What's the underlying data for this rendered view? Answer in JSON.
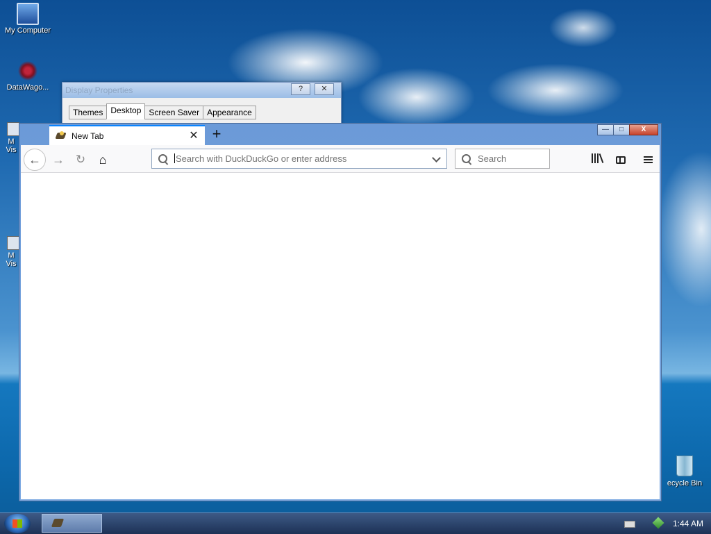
{
  "desktop": {
    "icons": [
      {
        "label": "My Computer"
      },
      {
        "label": "DataWago..."
      },
      {
        "label": "M\nVis"
      },
      {
        "label": "M\nVis"
      }
    ],
    "recycle_bin": {
      "label": "ecycle Bin"
    }
  },
  "dialog": {
    "title": "Display Properties",
    "help": "?",
    "close": "✕",
    "tabs": [
      "Themes",
      "Desktop",
      "Screen Saver",
      "Appearance"
    ],
    "active_tab": "Desktop"
  },
  "browser": {
    "tab_title": "New Tab",
    "tab_close": "✕",
    "new_tab": "+",
    "url_placeholder": "Search with DuckDuckGo or enter address",
    "search_placeholder": "Search",
    "nav": {
      "back": "←",
      "forward": "→",
      "reload": "↻",
      "home": "⌂"
    },
    "window_controls": {
      "minimize": "—",
      "maximize": "□",
      "close": "X"
    }
  },
  "taskbar": {
    "clock": "1:44 AM"
  },
  "colors": {
    "tab_accent": "#0a84ff",
    "frame": "#7eaae2"
  }
}
